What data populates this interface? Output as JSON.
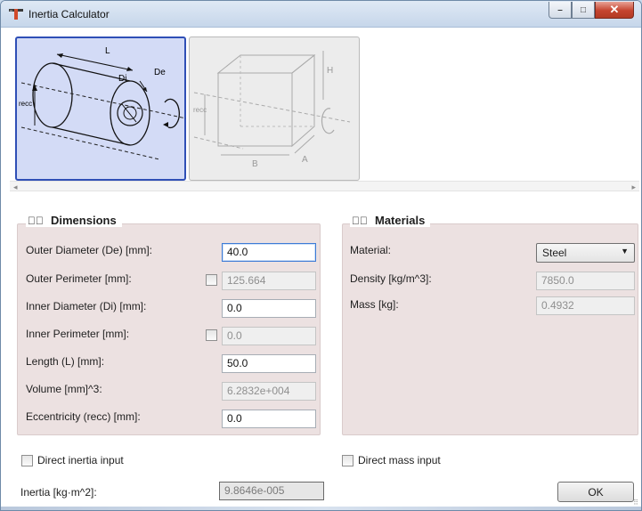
{
  "window": {
    "title": "Inertia Calculator",
    "app_icon": "t-shape-icon",
    "controls": {
      "minimize": "–",
      "maximize": "□",
      "close": "✕"
    }
  },
  "gallery": {
    "tiles": [
      {
        "name": "cylinder",
        "selected": true,
        "labels": {
          "length": "L",
          "inner_diameter": "Di",
          "outer_diameter": "De",
          "eccentricity": "recc"
        }
      },
      {
        "name": "box",
        "selected": false,
        "labels": {
          "height": "H",
          "width": "B",
          "depth": "A",
          "eccentricity": "recc"
        }
      }
    ],
    "scroll": {
      "left_arrow": "◂",
      "right_arrow": "▸"
    }
  },
  "dimensions": {
    "title": "Dimensions",
    "rows": [
      {
        "label": "Outer Diameter (De) [mm]:",
        "value": "40.0",
        "readonly": false,
        "checkbox": false
      },
      {
        "label": "Outer Perimeter [mm]:",
        "value": "125.664",
        "readonly": true,
        "checkbox": true
      },
      {
        "label": "Inner Diameter (Di) [mm]:",
        "value": "0.0",
        "readonly": false,
        "checkbox": false
      },
      {
        "label": "Inner Perimeter [mm]:",
        "value": "0.0",
        "readonly": true,
        "checkbox": true
      },
      {
        "label": "Length (L) [mm]:",
        "value": "50.0",
        "readonly": false,
        "checkbox": false
      },
      {
        "label": "Volume [mm]^3:",
        "value": "6.2832e+004",
        "readonly": true,
        "checkbox": false
      },
      {
        "label": "Eccentricity (recc) [mm]:",
        "value": "0.0",
        "readonly": false,
        "checkbox": false
      }
    ]
  },
  "materials": {
    "title": "Materials",
    "material_label": "Material:",
    "material_value": "Steel",
    "density_label": "Density [kg/m^3]:",
    "density_value": "7850.0",
    "mass_label": "Mass [kg]:",
    "mass_value": "0.4932"
  },
  "footer": {
    "direct_inertia": "Direct inertia input",
    "direct_mass": "Direct mass input",
    "inertia_label": "Inertia [kg·m^2]:",
    "inertia_value": "9.8646e-005",
    "ok": "OK"
  },
  "colors": {
    "panel_bg": "#ece1e1",
    "selected_tile_bg": "#d3dbf6",
    "selected_tile_border": "#2f4fb6"
  }
}
